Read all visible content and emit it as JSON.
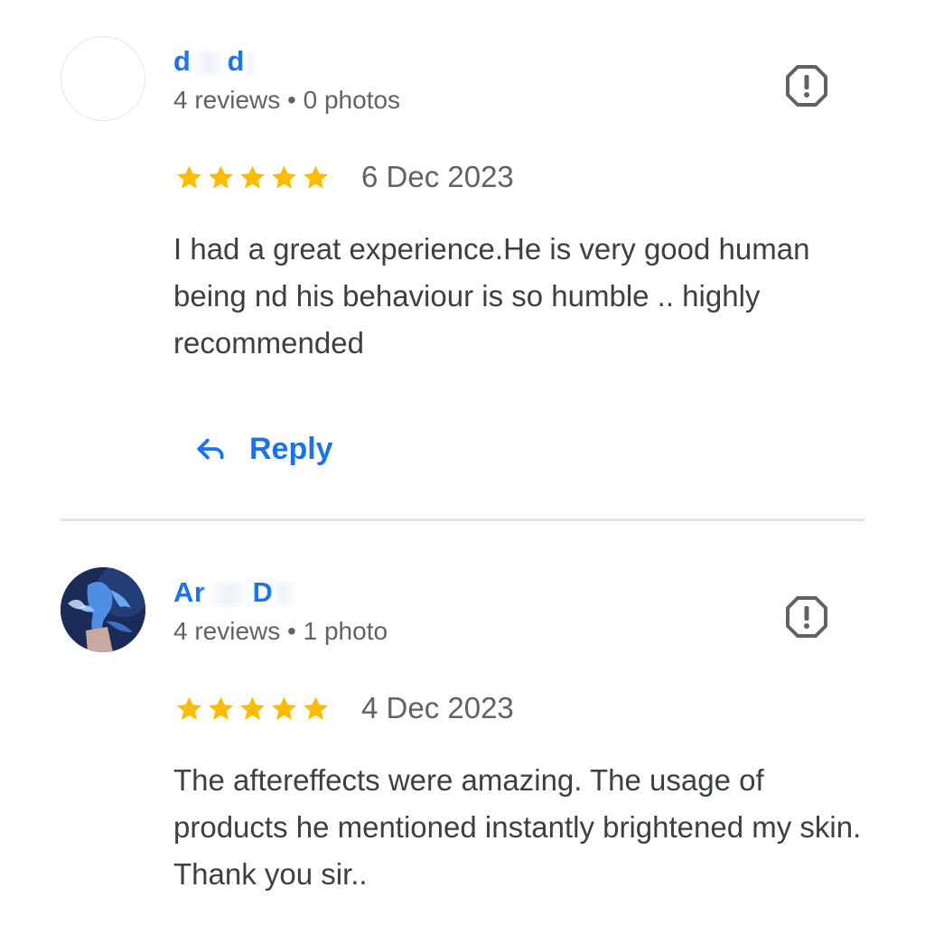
{
  "reviews": [
    {
      "author_visible_start": "d",
      "author_visible_mid": "d",
      "meta": "4 reviews • 0 photos",
      "rating": 5,
      "date": "6 Dec 2023",
      "text": "I had a great experience.He is very good human being nd his behaviour is so humble .. highly recommended",
      "reply_label": "Reply"
    },
    {
      "author_visible_start": "Ar",
      "author_visible_mid": "D",
      "meta": "4 reviews • 1 photo",
      "rating": 5,
      "date": "4 Dec 2023",
      "text": "The aftereffects were amazing. The usage of products he mentioned instantly brightened my skin. Thank you sir.."
    }
  ],
  "colors": {
    "accent": "#1a73e8",
    "star": "#fbbc04",
    "text": "#3c4043",
    "secondary_text": "#5f6368",
    "divider": "#e3e3e3"
  },
  "icons": {
    "report": "report-flag-icon",
    "reply": "reply-arrow-icon",
    "star": "star-icon"
  }
}
